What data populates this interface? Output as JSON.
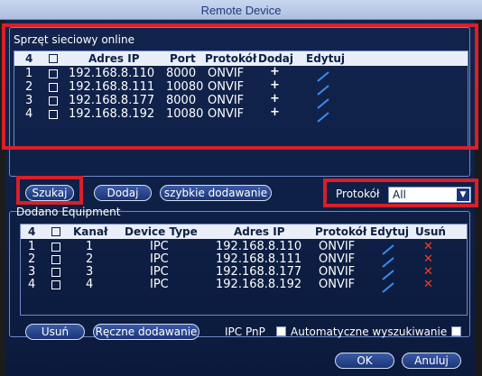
{
  "window": {
    "title": "Remote Device"
  },
  "online_group": {
    "title": "Sprzęt sieciowy online",
    "header": {
      "count": "4",
      "address": "Adres IP",
      "port": "Port",
      "protocol": "Protokół",
      "add": "Dodaj",
      "edit": "Edytuj"
    },
    "rows": [
      {
        "num": "1",
        "address": "192.168.8.110",
        "port": "8000",
        "protocol": "ONVIF"
      },
      {
        "num": "2",
        "address": "192.168.8.111",
        "port": "10080",
        "protocol": "ONVIF"
      },
      {
        "num": "3",
        "address": "192.168.8.177",
        "port": "8000",
        "protocol": "ONVIF"
      },
      {
        "num": "4",
        "address": "192.168.8.192",
        "port": "10080",
        "protocol": "ONVIF"
      }
    ]
  },
  "actions": {
    "search": "Szukaj",
    "add": "Dodaj",
    "quick_add": "szybkie dodawanie",
    "protocol_label": "Protokół",
    "protocol_value": "All"
  },
  "added_group": {
    "title": "Dodano Equipment",
    "header": {
      "count": "4",
      "channel": "Kanał",
      "type": "Device Type",
      "address": "Adres IP",
      "protocol": "Protokół",
      "edit": "Edytuj",
      "delete": "Usuń"
    },
    "rows": [
      {
        "num": "1",
        "channel": "1",
        "type": "IPC",
        "address": "192.168.8.110",
        "protocol": "ONVIF"
      },
      {
        "num": "2",
        "channel": "2",
        "type": "IPC",
        "address": "192.168.8.111",
        "protocol": "ONVIF"
      },
      {
        "num": "3",
        "channel": "3",
        "type": "IPC",
        "address": "192.168.8.177",
        "protocol": "ONVIF"
      },
      {
        "num": "4",
        "channel": "4",
        "type": "IPC",
        "address": "192.168.8.192",
        "protocol": "ONVIF"
      }
    ]
  },
  "bottom": {
    "delete": "Usuń",
    "manual_add": "Ręczne dodawanie",
    "ipc_pnp": "IPC PnP",
    "auto_search": "Automatyczne wyszukiwanie",
    "ok": "OK",
    "cancel": "Anuluj"
  },
  "colors": {
    "highlight": "#d81f2a",
    "delete_icon": "#ff3a1e",
    "edit_icon": "#3a8df0"
  }
}
